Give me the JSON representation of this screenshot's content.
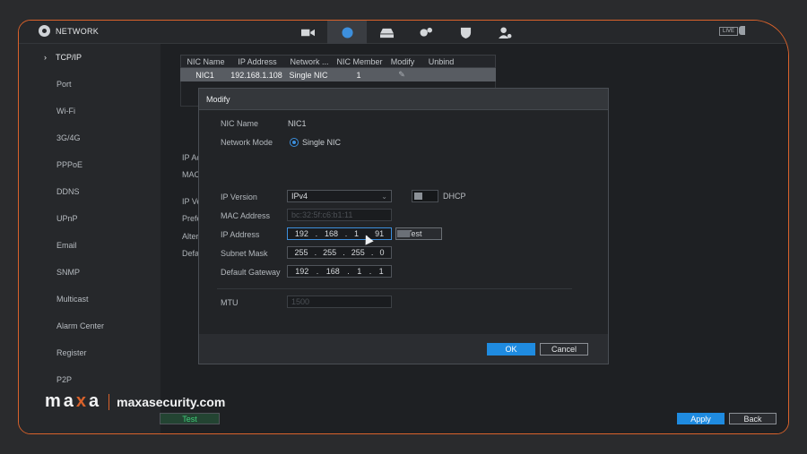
{
  "topbar": {
    "title": "NETWORK",
    "live": "LIVE",
    "tabs": [
      "camera-icon",
      "network-globe-icon",
      "storage-icon",
      "system-settings-icon",
      "security-shield-icon",
      "account-icon"
    ]
  },
  "sidebar": {
    "items": [
      {
        "label": "TCP/IP",
        "active": true
      },
      {
        "label": "Port"
      },
      {
        "label": "Wi-Fi"
      },
      {
        "label": "3G/4G"
      },
      {
        "label": "PPPoE"
      },
      {
        "label": "DDNS"
      },
      {
        "label": "UPnP"
      },
      {
        "label": "Email"
      },
      {
        "label": "SNMP"
      },
      {
        "label": "Multicast"
      },
      {
        "label": "Alarm Center"
      },
      {
        "label": "Register"
      },
      {
        "label": "P2P"
      }
    ]
  },
  "nic_table": {
    "headers": [
      "NIC Name",
      "IP Address",
      "Network ...",
      "NIC Member",
      "Modify",
      "Unbind"
    ],
    "rows": [
      {
        "nic_name": "NIC1",
        "ip_address": "192.168.1.108",
        "network": "Single NIC",
        "nic_member": "1"
      }
    ]
  },
  "background_labels": [
    "IP Ac",
    "MAC",
    "IP Ve",
    "Prefe",
    "Alter",
    "Defa"
  ],
  "modal": {
    "title": "Modify",
    "nic_name_label": "NIC Name",
    "nic_name_value": "NIC1",
    "network_mode_label": "Network Mode",
    "network_mode_value": "Single NIC",
    "ip_version_label": "IP Version",
    "ip_version_value": "IPv4",
    "dhcp_label": "DHCP",
    "mac_label": "MAC Address",
    "mac_value": "bc:32:5f:c6:b1:11",
    "ip_label": "IP Address",
    "ip_octets": [
      "192",
      "168",
      "1",
      "91"
    ],
    "test_label": "Test",
    "subnet_label": "Subnet Mask",
    "subnet_octets": [
      "255",
      "255",
      "255",
      "0"
    ],
    "gateway_label": "Default Gateway",
    "gateway_octets": [
      "192",
      "168",
      "1",
      "1"
    ],
    "mtu_label": "MTU",
    "mtu_value": "1500",
    "ok_label": "OK",
    "cancel_label": "Cancel"
  },
  "footer": {
    "test_label": "Test",
    "apply_label": "Apply",
    "back_label": "Back"
  },
  "watermark": {
    "brand_m": "m",
    "brand_a": "a",
    "brand_x": "x",
    "brand_a2": "a",
    "site": "maxasecurity.com"
  },
  "colors": {
    "frame_border": "#d9622b",
    "accent_blue": "#1f8be0",
    "test_green": "#3fd07a"
  }
}
